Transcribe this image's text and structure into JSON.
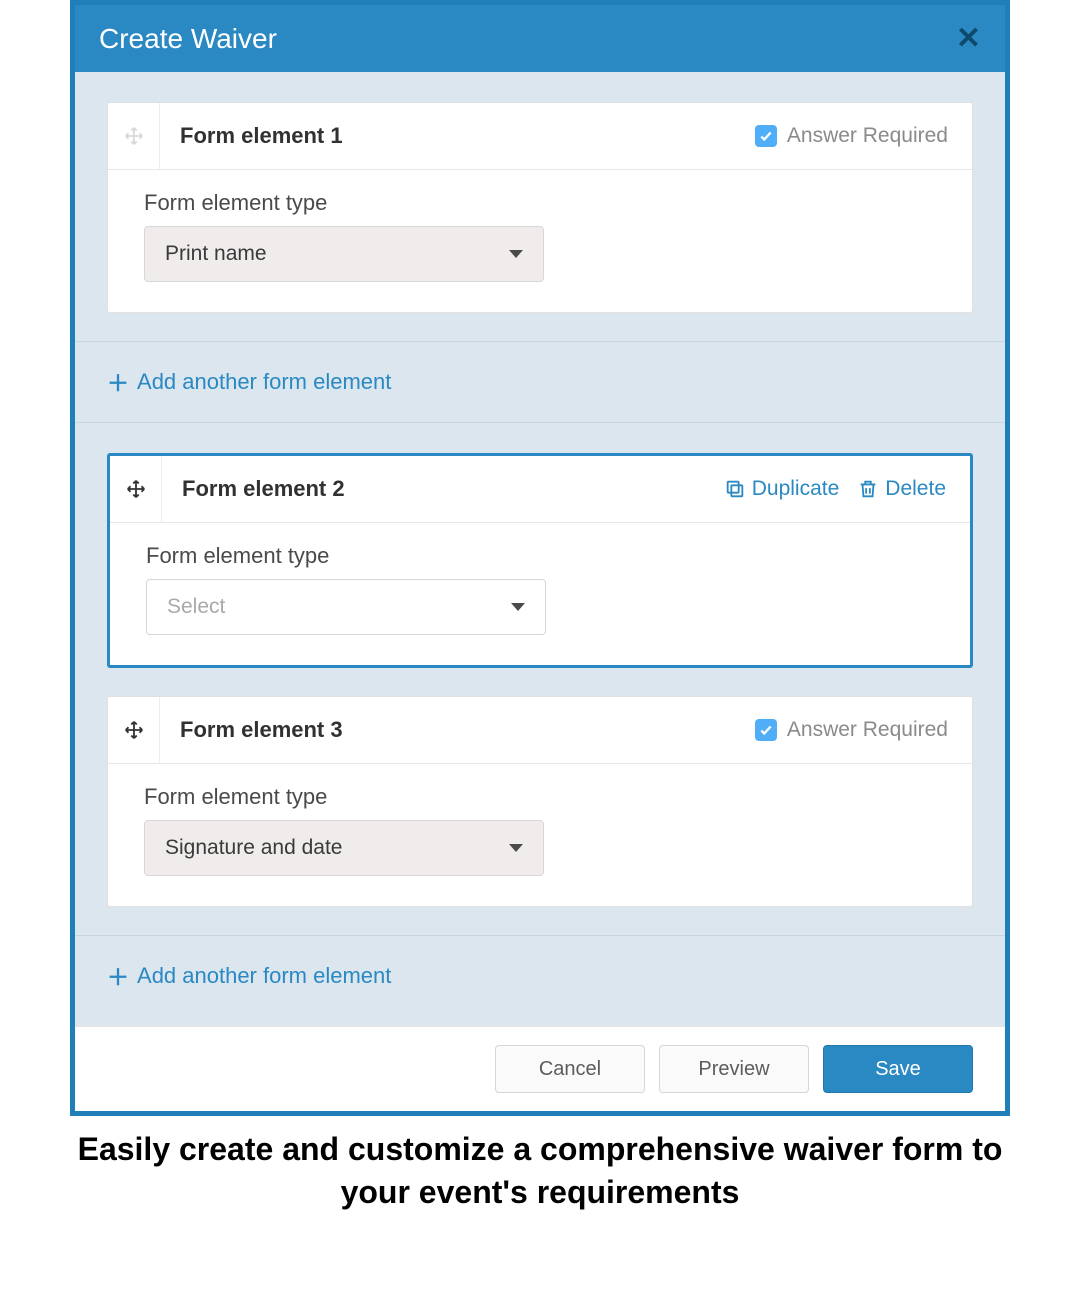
{
  "colors": {
    "accent": "#2a89c2",
    "header": "#2a89c2",
    "border_active": "#2a89c2",
    "body_bg": "#dce6ef",
    "checkbox": "#4faef7"
  },
  "modal": {
    "title": "Create Waiver"
  },
  "labels": {
    "element_type": "Form element type",
    "answer_required": "Answer Required",
    "add_element": "Add another form element",
    "duplicate": "Duplicate",
    "delete": "Delete",
    "select_placeholder": "Select"
  },
  "elements": [
    {
      "title": "Form element 1",
      "type_value": "Print name",
      "required": true,
      "active": false,
      "drag_muted": true
    },
    {
      "title": "Form element 2",
      "type_value": "",
      "required": false,
      "active": true,
      "drag_muted": false
    },
    {
      "title": "Form element 3",
      "type_value": "Signature and date",
      "required": true,
      "active": false,
      "drag_muted": false
    }
  ],
  "footer": {
    "cancel": "Cancel",
    "preview": "Preview",
    "save": "Save"
  },
  "caption": "Easily create and customize a comprehensive waiver form to your event's requirements"
}
